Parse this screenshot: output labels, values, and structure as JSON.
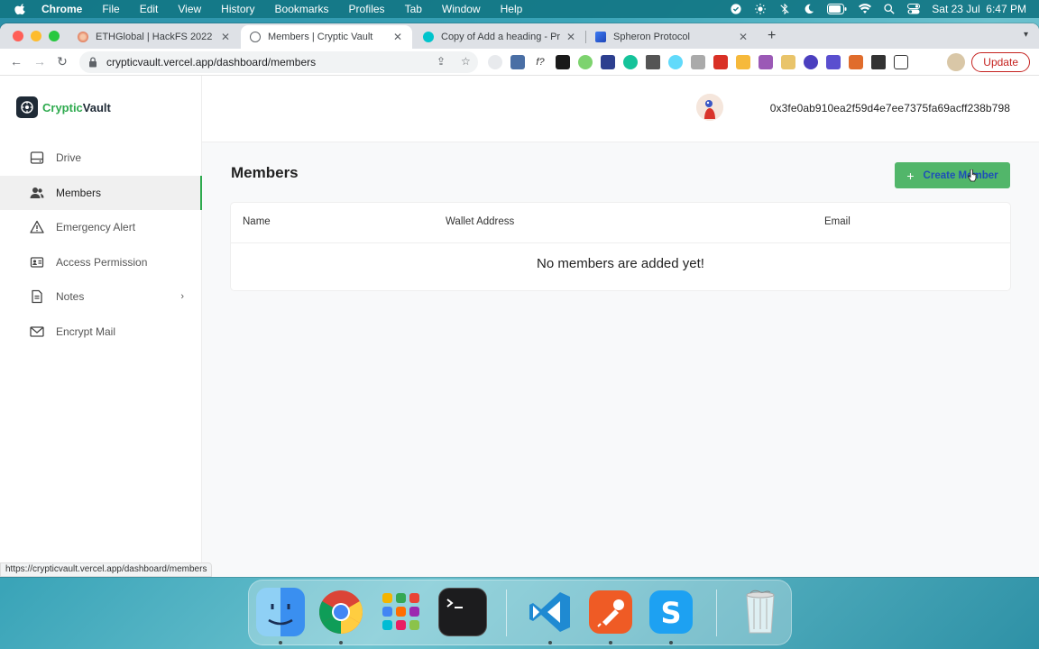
{
  "menubar": {
    "items": [
      "Chrome",
      "File",
      "Edit",
      "View",
      "History",
      "Bookmarks",
      "Profiles",
      "Tab",
      "Window",
      "Help"
    ],
    "datetime": "Sat 23 Jul  6:47 PM"
  },
  "browser": {
    "tabs": [
      {
        "title": "ETHGlobal | HackFS 2022",
        "active": false
      },
      {
        "title": "Members | Cryptic Vault",
        "active": true
      },
      {
        "title": "Copy of Add a heading - Prese",
        "active": false
      },
      {
        "title": "Spheron Protocol",
        "active": false
      }
    ],
    "url": "crypticvault.vercel.app/dashboard/members",
    "update_label": "Update",
    "status_url": "https://crypticvault.vercel.app/dashboard/members"
  },
  "app": {
    "logo": {
      "part1": "Cryptic",
      "part2": "Vault"
    },
    "nav": [
      {
        "label": "Drive",
        "icon": "drive-icon"
      },
      {
        "label": "Members",
        "icon": "members-icon",
        "active": true
      },
      {
        "label": "Emergency Alert",
        "icon": "alert-icon"
      },
      {
        "label": "Access Permission",
        "icon": "access-icon"
      },
      {
        "label": "Notes",
        "icon": "notes-icon",
        "has_submenu": true
      },
      {
        "label": "Encrypt Mail",
        "icon": "mail-icon"
      }
    ],
    "wallet_address": "0x3fe0ab910ea2f59d4e7ee7375fa69acff238b798",
    "page_title": "Members",
    "create_button": "Create Member",
    "table": {
      "columns": [
        "Name",
        "Wallet Address",
        "Email"
      ],
      "empty_message": "No members are added yet!"
    },
    "colors": {
      "accent": "#52b66a",
      "brand_dark": "#1f2a36",
      "active_marker": "#2eaa4e"
    }
  },
  "dock": {
    "apps": [
      "Finder",
      "Chrome",
      "Launchpad",
      "Terminal",
      "Visual Studio Code",
      "Postman",
      "Skype",
      "Trash"
    ]
  }
}
